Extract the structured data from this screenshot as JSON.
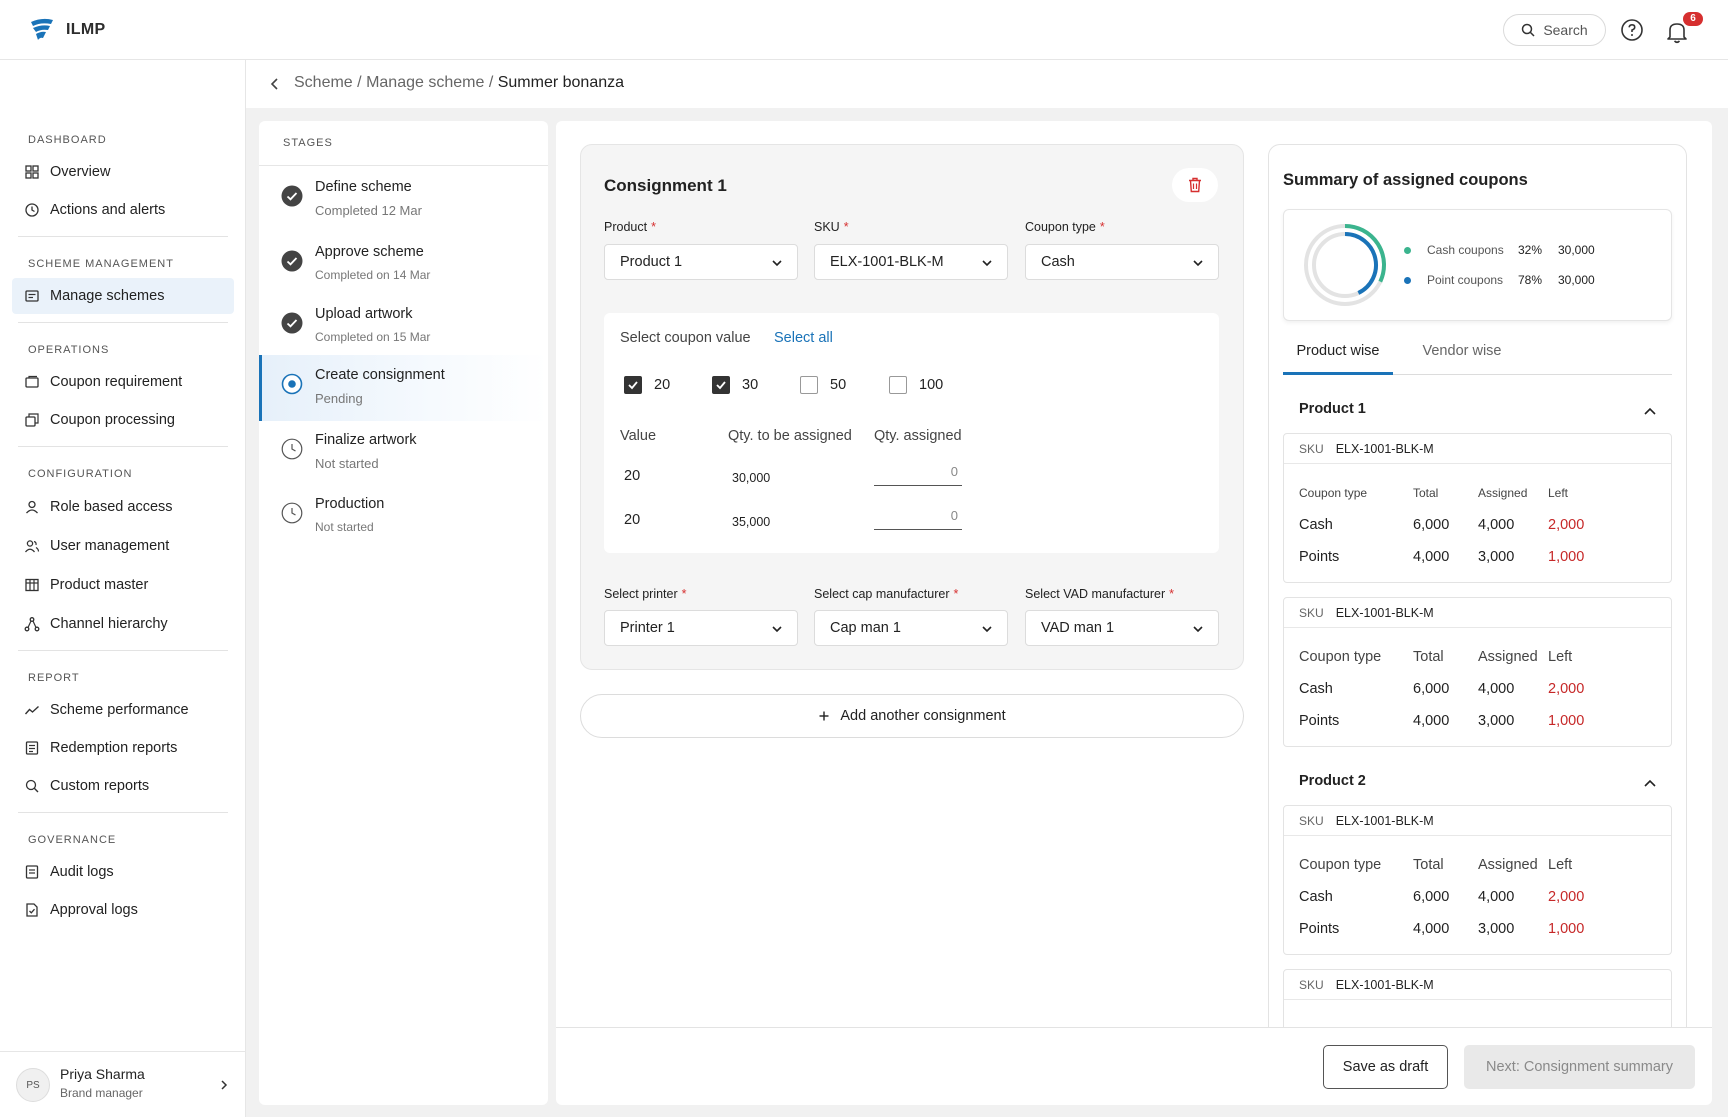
{
  "app": {
    "name": "ILMP"
  },
  "header": {
    "search_label": "Search",
    "notification_count": "6"
  },
  "sidebar": {
    "sections": [
      {
        "title": "DASHBOARD",
        "items": [
          "Overview",
          "Actions and alerts"
        ]
      },
      {
        "title": "SCHEME MANAGEMENT",
        "items": [
          "Manage schemes"
        ]
      },
      {
        "title": "OPERATIONS",
        "items": [
          "Coupon requirement",
          "Coupon processing"
        ]
      },
      {
        "title": "CONFIGURATION",
        "items": [
          "Role based access",
          "User management",
          "Product master",
          "Channel hierarchy"
        ]
      },
      {
        "title": "REPORT",
        "items": [
          "Scheme performance",
          "Redemption reports",
          "Custom reports"
        ]
      },
      {
        "title": "GOVERNANCE",
        "items": [
          "Audit logs",
          "Approval logs"
        ]
      }
    ],
    "active_item": "Manage schemes",
    "user": {
      "initials": "PS",
      "name": "Priya Sharma",
      "role": "Brand manager"
    }
  },
  "breadcrumb": {
    "items": [
      "Scheme",
      "Manage scheme"
    ],
    "current": "Summer bonanza",
    "separator": "/"
  },
  "stages": {
    "title": "STAGES",
    "items": [
      {
        "name": "Define scheme",
        "status": "Completed 12 Mar",
        "state": "done"
      },
      {
        "name": "Approve scheme",
        "status": "Completed on 14 Mar",
        "state": "done"
      },
      {
        "name": "Upload artwork",
        "status": "Completed on 15 Mar",
        "state": "done"
      },
      {
        "name": "Create consignment",
        "status": "Pending",
        "state": "current"
      },
      {
        "name": "Finalize artwork",
        "status": "Not started",
        "state": "todo"
      },
      {
        "name": "Production",
        "status": "Not started",
        "state": "todo"
      }
    ]
  },
  "consignment": {
    "title": "Consignment 1",
    "fields": {
      "product": {
        "label": "Product",
        "value": "Product 1"
      },
      "sku": {
        "label": "SKU",
        "value": "ELX-1001-BLK-M"
      },
      "coupon_type": {
        "label": "Coupon type",
        "value": "Cash"
      },
      "printer": {
        "label": "Select printer",
        "value": "Printer 1"
      },
      "cap_manufacturer": {
        "label": "Select cap manufacturer",
        "value": "Cap man 1"
      },
      "vad_manufacturer": {
        "label": "Select VAD manufacturer",
        "value": "VAD man 1"
      }
    },
    "coupon_value": {
      "label": "Select coupon value",
      "select_all": "Select all",
      "options": [
        {
          "value": "20",
          "checked": true
        },
        {
          "value": "30",
          "checked": true
        },
        {
          "value": "50",
          "checked": false
        },
        {
          "value": "100",
          "checked": false
        }
      ]
    },
    "table": {
      "headers": [
        "Value",
        "Qty. to be assigned",
        "Qty. assigned"
      ],
      "rows": [
        {
          "value": "20",
          "qty_to_assign": "30,000",
          "qty_assigned": "0"
        },
        {
          "value": "20",
          "qty_to_assign": "35,000",
          "qty_assigned": "0"
        }
      ]
    },
    "add_label": "Add another consignment"
  },
  "actions": {
    "save_draft": "Save as draft",
    "next": "Next: Consignment summary"
  },
  "summary": {
    "title": "Summary of assigned coupons",
    "legend": [
      {
        "name": "Cash coupons",
        "pct": "32%",
        "amount": "30,000",
        "color": "#3bb48e"
      },
      {
        "name": "Point coupons",
        "pct": "78%",
        "amount": "30,000",
        "color": "#1a73b8"
      }
    ],
    "tabs": [
      "Product wise",
      "Vendor wise"
    ],
    "active_tab": "Product wise",
    "sku_label": "SKU",
    "col_headers": [
      "Coupon type",
      "Total",
      "Assigned",
      "Left"
    ],
    "products": [
      {
        "name": "Product 1",
        "skus": [
          {
            "sku": "ELX-1001-BLK-M",
            "rows": [
              [
                "Cash",
                "6,000",
                "4,000",
                "2,000"
              ],
              [
                "Points",
                "4,000",
                "3,000",
                "1,000"
              ]
            ]
          },
          {
            "sku": "ELX-1001-BLK-M",
            "rows": [
              [
                "Cash",
                "6,000",
                "4,000",
                "2,000"
              ],
              [
                "Points",
                "4,000",
                "3,000",
                "1,000"
              ]
            ]
          }
        ]
      },
      {
        "name": "Product 2",
        "skus": [
          {
            "sku": "ELX-1001-BLK-M",
            "rows": [
              [
                "Cash",
                "6,000",
                "4,000",
                "2,000"
              ],
              [
                "Points",
                "4,000",
                "3,000",
                "1,000"
              ]
            ]
          },
          {
            "sku": "ELX-1001-BLK-M",
            "rows": []
          }
        ]
      }
    ]
  }
}
